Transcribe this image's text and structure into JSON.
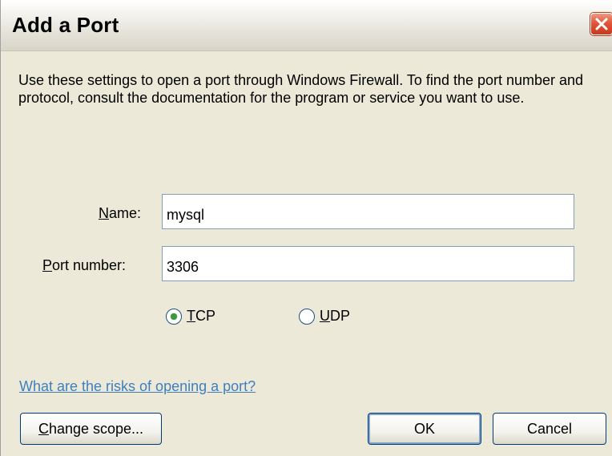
{
  "dialog": {
    "title": "Add a Port",
    "description": "Use these settings to open a port through Windows Firewall. To find the port number and protocol, consult the documentation for the program or service you want to use."
  },
  "name_field": {
    "label_mnemonic": "N",
    "label_rest": "ame:",
    "value": "mysql"
  },
  "port_field": {
    "label_mnemonic": "P",
    "label_rest": "ort number:",
    "value": "3306"
  },
  "protocol": {
    "options": [
      {
        "mnemonic": "T",
        "rest": "CP",
        "selected": true
      },
      {
        "mnemonic": "U",
        "rest": "DP",
        "selected": false
      }
    ]
  },
  "risks_link": "What are the risks of opening a port?",
  "buttons": {
    "change_scope_mnemonic": "C",
    "change_scope_rest": "hange scope...",
    "ok": "OK",
    "cancel": "Cancel"
  },
  "colors": {
    "dialog_bg": "#ECE9D8",
    "link": "#3F7FBF",
    "close_red": "#E0563A",
    "radio_selected": "#3C9A3C"
  },
  "icons": {
    "close": "close-icon"
  }
}
